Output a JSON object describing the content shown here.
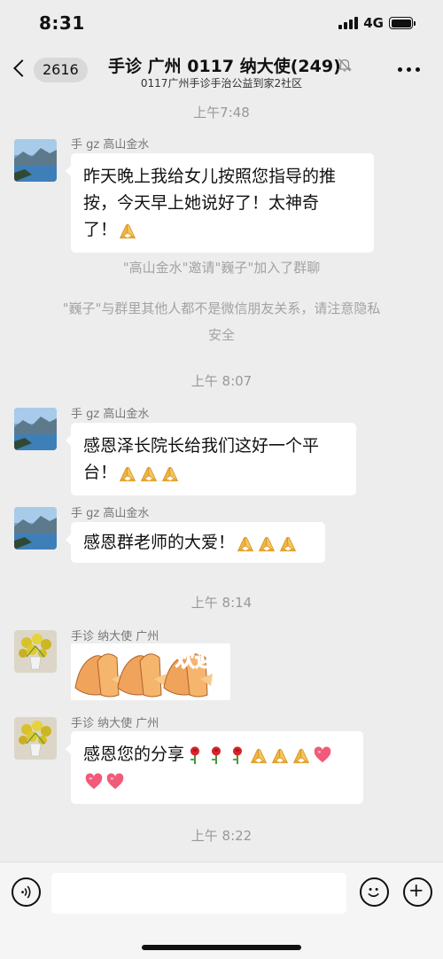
{
  "status_bar": {
    "time": "8:31",
    "network": "4G"
  },
  "nav": {
    "back_count": "2616",
    "title": "手诊 广州 0117 纳大使(249)",
    "subtitle": "0117广州手诊手治公益到家2社区"
  },
  "messages": {
    "ts1": "上午7:48",
    "m1": {
      "sender": "手 gz 高山金水",
      "line1": "昨天晚上我给女儿按照您指导的推",
      "line2": "按，今天早上她说好了！太神奇",
      "line3": "了！"
    },
    "sys1": "\"高山金水\"邀请\"巍子\"加入了群聊",
    "sys2_line1": "\"巍子\"与群里其他人都不是微信朋友关系，请注意隐私",
    "sys2_line2": "安全",
    "ts2": "上午 8:07",
    "m2": {
      "sender": "手 gz 高山金水",
      "line1": "感恩泽长院长给我们这好一个平",
      "line2": "台！"
    },
    "m3": {
      "sender": "手 gz 高山金水",
      "text": "感恩群老师的大爱！"
    },
    "ts3": "上午 8:14",
    "m4": {
      "sender": "手诊 纳大使 广州",
      "sticker_text": "欢迎"
    },
    "m5": {
      "sender": "手诊 纳大使 广州",
      "text": "感恩您的分享"
    },
    "ts4": "上午 8:22"
  },
  "icons": {
    "back": "chevron-left-icon",
    "mute": "mute-bell-icon",
    "more": "more-dots-icon",
    "pray": "praying-hands-emoji",
    "rose": "rose-emoji",
    "heart": "heart-emoji",
    "voice": "voice-icon",
    "emoji": "smiley-icon",
    "plus": "plus-icon"
  },
  "colors": {
    "background": "#ededed",
    "bubble": "#ffffff",
    "system_text": "#a3a3a3"
  }
}
